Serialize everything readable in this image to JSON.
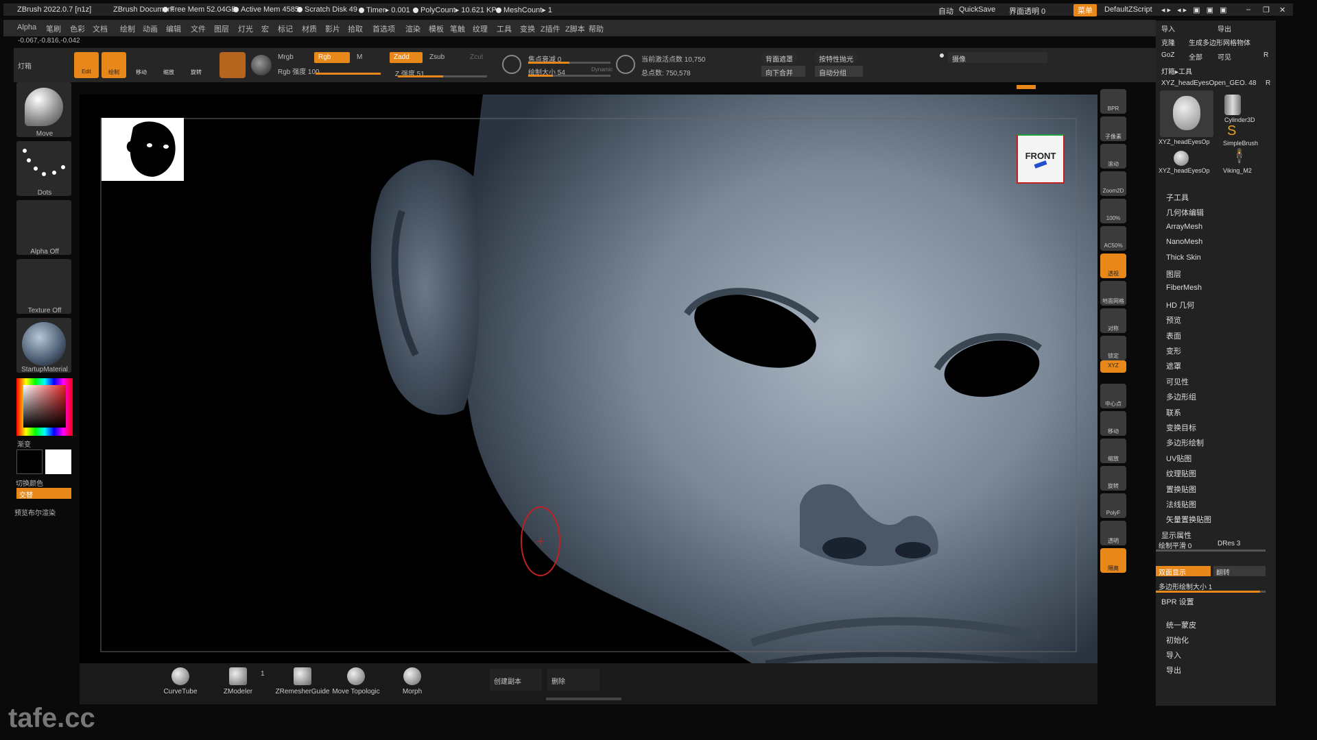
{
  "title": {
    "app": "ZBrush 2022.0.7 [n1z]",
    "doc": "ZBrush Document",
    "free_mem": "Free Mem 52.04GB",
    "active_mem": "Active Mem 4585",
    "scratch": "Scratch Disk 49",
    "timer": "Timer▸ 0.001",
    "polycount": "PolyCount▸ 10.621 KP",
    "meshcount": "MeshCount▸ 1",
    "auto": "自动",
    "quicksave": "QuickSave",
    "transparency": "界面透明 0",
    "menu_btn": "菜单",
    "script": "DefaultZScript"
  },
  "menu": [
    "Alpha",
    "笔刷",
    "色彩",
    "文档",
    "绘制",
    "动画",
    "编辑",
    "文件",
    "图层",
    "灯光",
    "宏",
    "标记",
    "材质",
    "影片",
    "拾取",
    "首选项",
    "渲染",
    "模板",
    "笔触",
    "纹理",
    "工具",
    "变换",
    "Z插件",
    "Z脚本",
    "帮助"
  ],
  "coords": "-0.067,-0.816,-0.042",
  "topbar": {
    "lightbox": "灯箱",
    "edit": "Edit",
    "draw": "绘制",
    "move": "移动",
    "scale": "缩放",
    "rotate": "旋转",
    "mrgb": "Mrgb",
    "rgb": "Rgb",
    "m": "M",
    "rgb_intensity": "Rgb 强度 100",
    "zadd": "Zadd",
    "zsub": "Zsub",
    "zcut": "Zcut",
    "z_intensity": "Z 强度 51",
    "focal": "焦点衰减 0",
    "draw_size": "绘制大小 54",
    "dynamic": "Dynamic",
    "active_points": "当前激活点数 10,750",
    "total_points": "总点数: 750,578",
    "backface": "背面遮罩",
    "merge_down": "向下合并",
    "polish": "按特性抛光",
    "auto_group": "自动分组",
    "camera": "摄像"
  },
  "left": {
    "brush": "Move",
    "stroke": "Dots",
    "alpha": "Alpha Off",
    "texture": "Texture Off",
    "material": "StartupMaterial",
    "gradient": "渐变",
    "switch_color": "切换颜色",
    "alternate": "交替",
    "preview": "预览布尔渲染"
  },
  "navcube": "FRONT",
  "right_toolbar": [
    "BPR",
    "子像素",
    "滚动",
    "Zoom2D",
    "100%",
    "AC50%",
    "透视",
    "地面网格",
    "对称",
    "锁定",
    "XYZ",
    "中心点",
    "移动",
    "缩放",
    "旋转",
    "PolyF",
    "透明",
    "隔离"
  ],
  "right_panel": {
    "import": "导入",
    "export": "导出",
    "clone": "克隆",
    "make_poly": "生成多边形网格物体",
    "goz": "GoZ",
    "all": "全部",
    "visible": "可见",
    "r": "R",
    "lightbox_tool": "灯箱▸工具",
    "current_tool": "XYZ_headEyesOpen_GEO. 48",
    "thumb1": "XYZ_headEyesOp",
    "thumb2": "Cylinder3D",
    "thumb3": "SimpleBrush",
    "thumb4": "XYZ_headEyesOp",
    "thumb5": "Viking_M2",
    "items": [
      "子工具",
      "几何体编辑",
      "ArrayMesh",
      "NanoMesh",
      "Thick Skin",
      "图层",
      "FiberMesh",
      "HD 几何",
      "预览",
      "表面",
      "变形",
      "遮罩",
      "可见性",
      "多边形组",
      "联系",
      "变换目标",
      "多边形绘制",
      "UV贴图",
      "纹理贴图",
      "置换贴图",
      "法线贴图",
      "矢量置换贴图",
      "显示属性"
    ],
    "draw_smooth": "绘制平滑 0",
    "dres": "DRes 3",
    "double": "双面显示",
    "flip": "翻转",
    "poly_size": "多边形绘制大小 1",
    "bpr": "BPR 设置",
    "unify": "统一蒙皮",
    "init": "初始化",
    "import2": "导入",
    "export2": "导出"
  },
  "bottom": {
    "curvetube": "CurveTube",
    "zmodeler": "ZModeler",
    "zmodeler_count": "1",
    "zremesher": "ZRemesherGuide",
    "move_topo": "Move Topologic",
    "morph": "Morph",
    "duplicate": "创建副本",
    "delete": "删除"
  },
  "watermark": "tafe.cc",
  "colors": {
    "accent": "#e8881a",
    "bg": "#0a0a0a",
    "panel": "#2a2a2a",
    "skin": "#7a8898"
  }
}
